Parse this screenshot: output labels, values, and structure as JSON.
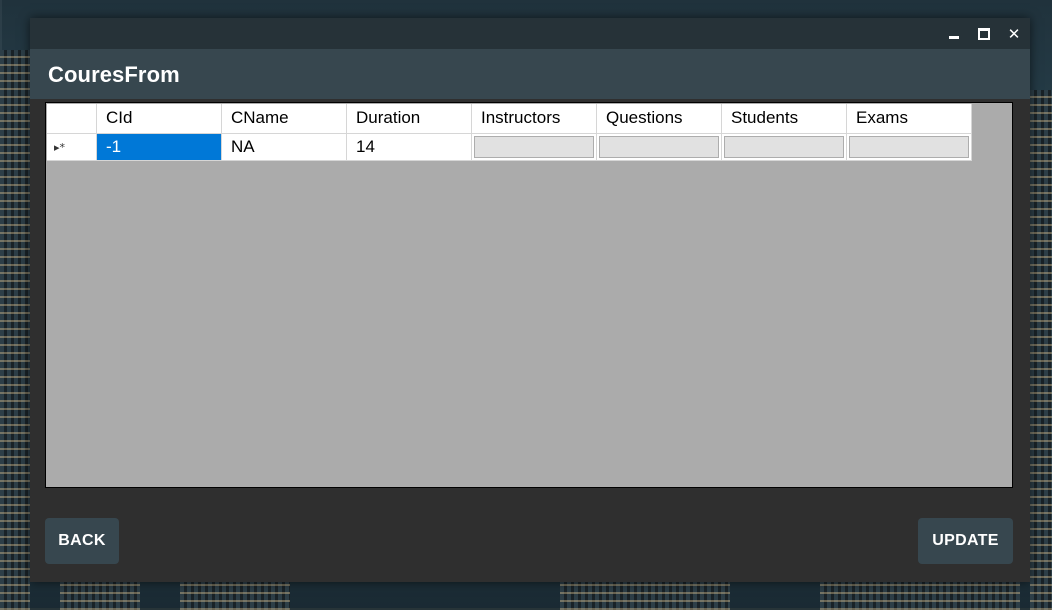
{
  "window": {
    "title": "CouresFrom",
    "controls": {
      "minimize_icon": "minimize-icon",
      "maximize_icon": "maximize-icon",
      "close_icon": "close-icon",
      "close_glyph": "✕"
    }
  },
  "grid": {
    "columns": [
      "CId",
      "CName",
      "Duration",
      "Instructors",
      "Questions",
      "Students",
      "Exams"
    ],
    "rows": [
      {
        "marker": "▸*",
        "CId": "-1",
        "CName": "NA",
        "Duration": "14"
      }
    ]
  },
  "buttons": {
    "back": "BACK",
    "update": "UPDATE"
  },
  "colors": {
    "header": "#37474f",
    "titlebar": "#263238",
    "window": "#2f2f2f",
    "grid_bg": "#ababab",
    "selection": "#0078d7"
  }
}
